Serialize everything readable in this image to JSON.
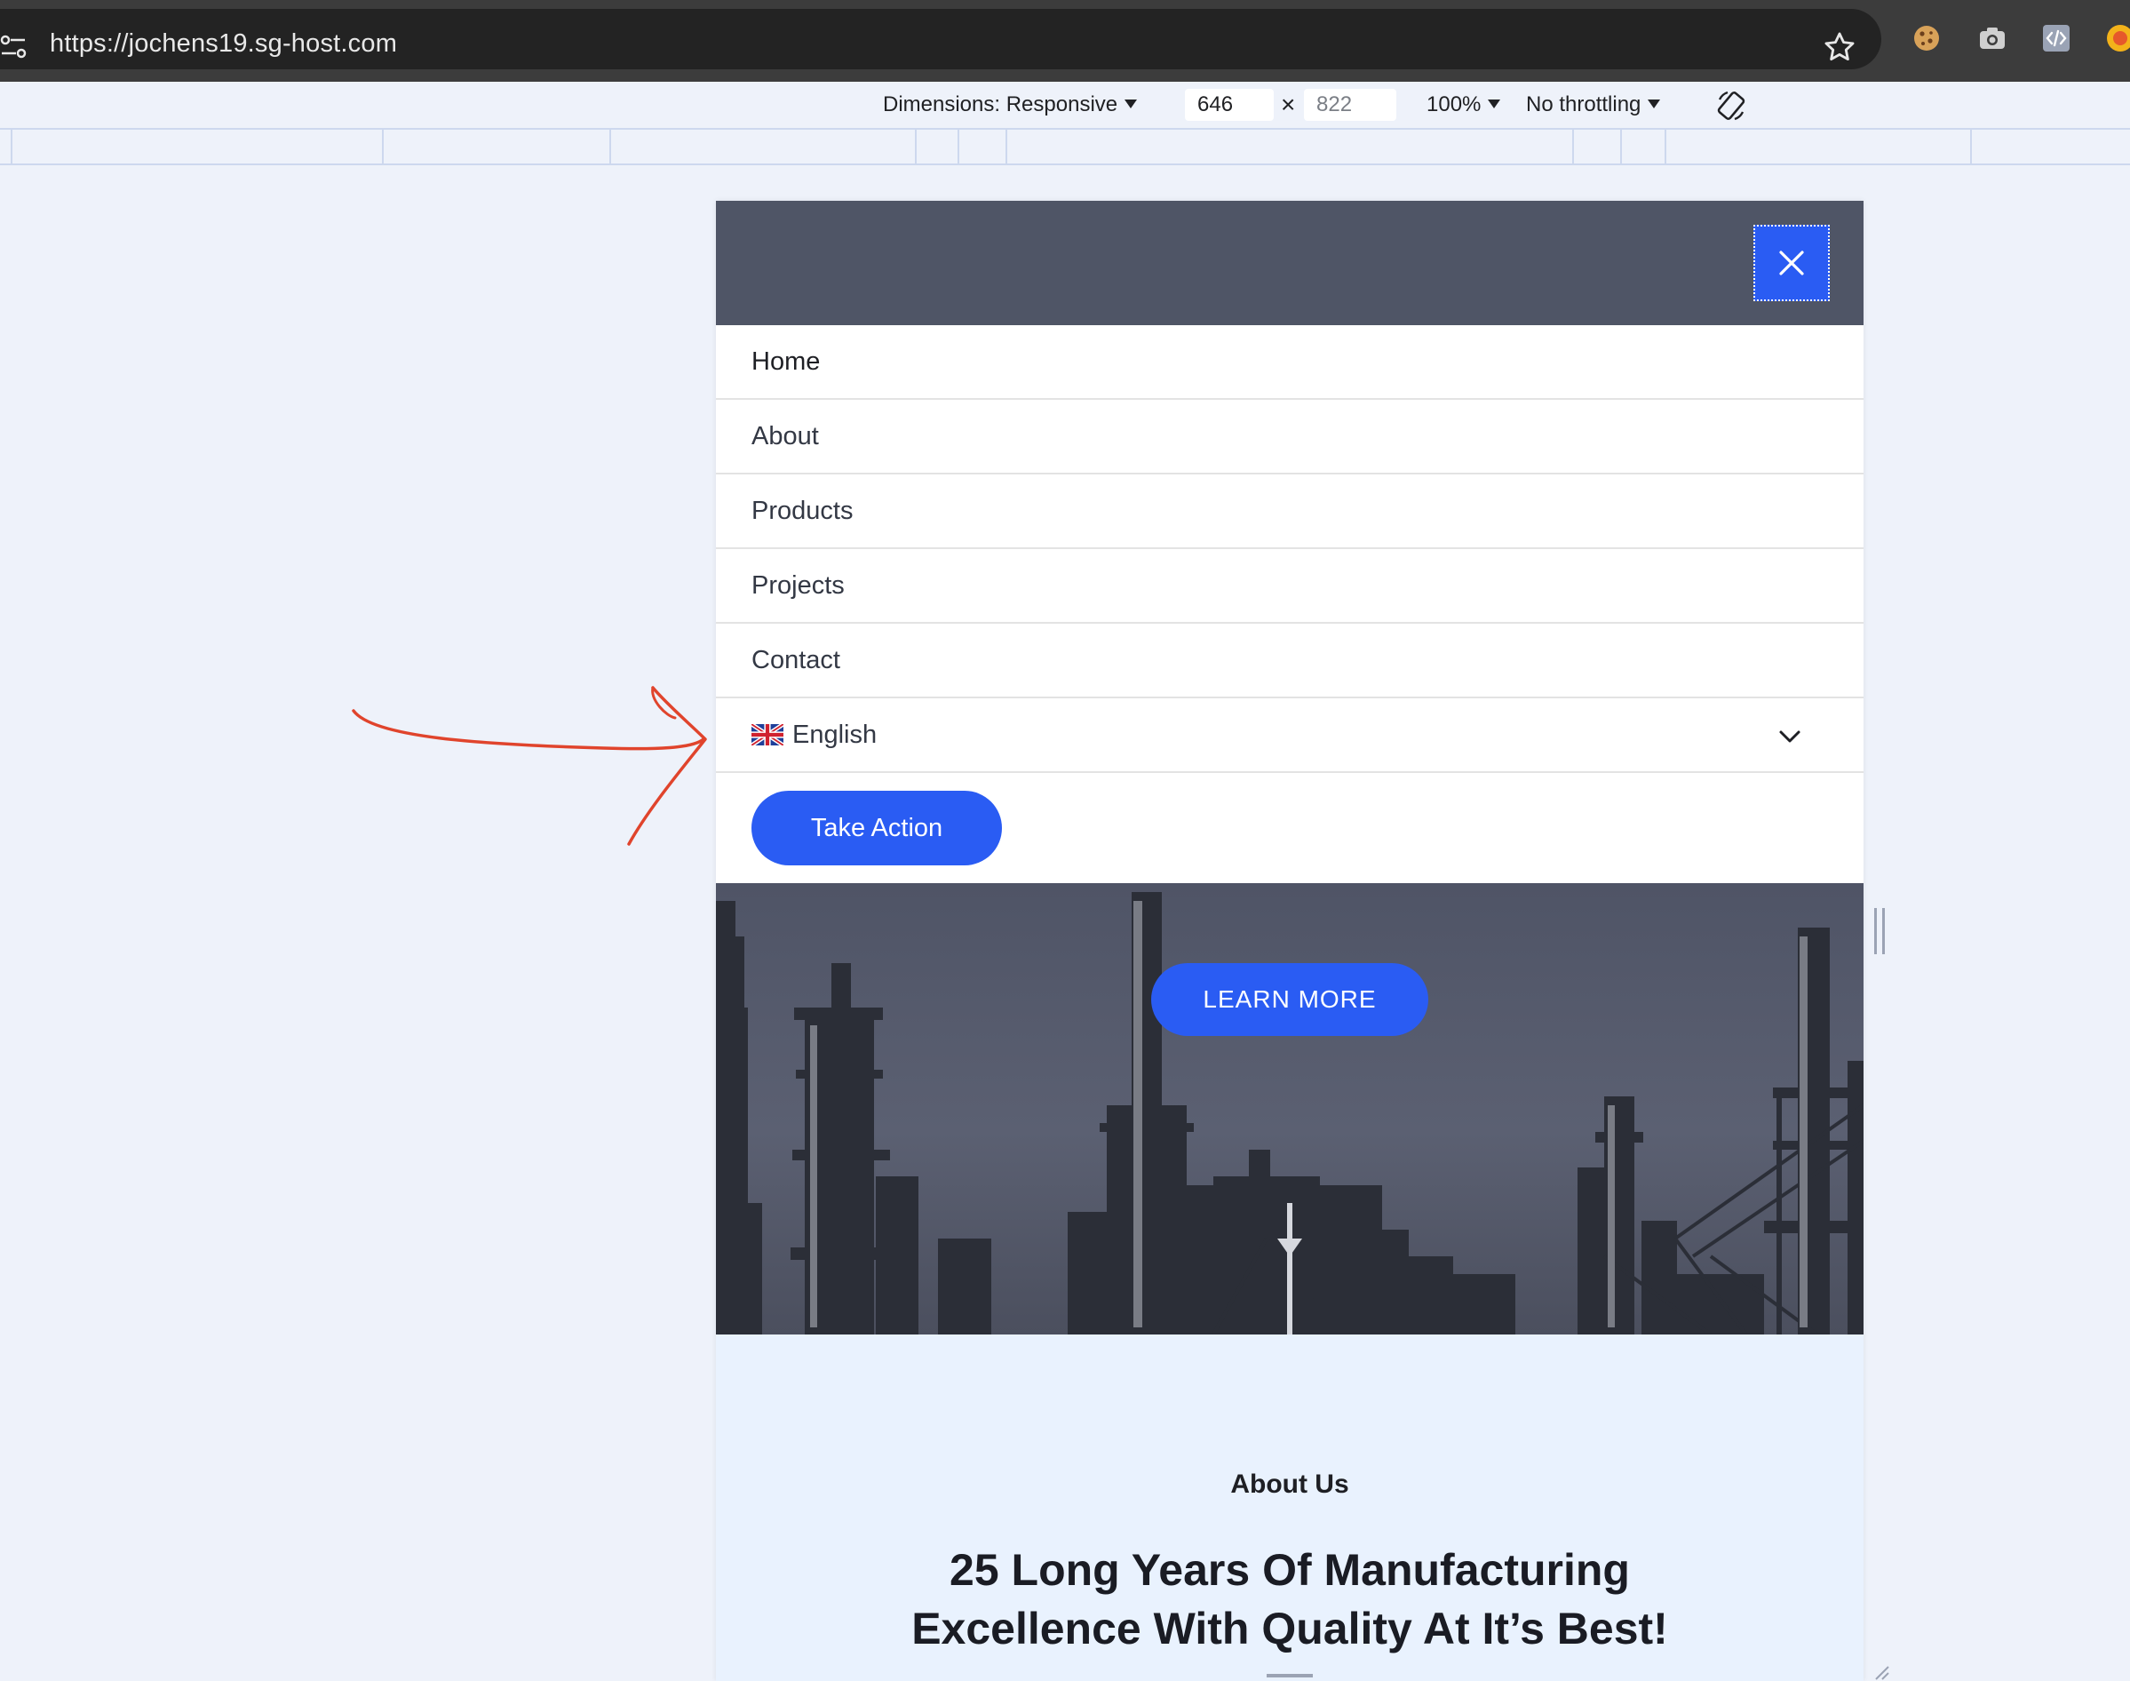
{
  "browser": {
    "url": "https://jochens19.sg-host.com",
    "icons": [
      "site-info-icon",
      "bookmark-star-icon",
      "cookie-extension-icon",
      "camera-extension-icon",
      "code-extension-icon",
      "seo-extension-icon"
    ]
  },
  "devtools": {
    "dimensions_label": "Dimensions: Responsive",
    "width_value": "646",
    "times_symbol": "×",
    "height_value": "822",
    "zoom_label": "100%",
    "throttling_label": "No throttling"
  },
  "site": {
    "menu": {
      "items": [
        {
          "label": "Home"
        },
        {
          "label": "About"
        },
        {
          "label": "Products"
        },
        {
          "label": "Projects"
        },
        {
          "label": "Contact"
        }
      ],
      "language": {
        "label": "English",
        "flag": "uk-flag-icon"
      },
      "cta_label": "Take Action"
    },
    "hero": {
      "button_label": "LEARN MORE"
    },
    "about": {
      "label": "About Us",
      "heading_line1": "25 Long Years Of Manufacturing",
      "heading_line2": "Excellence With Quality At It’s Best!"
    }
  },
  "colors": {
    "accent": "#2a5cf3",
    "menu_header": "#4f5566",
    "about_bg": "#e9f2fe",
    "annotation": "#e0442c"
  }
}
